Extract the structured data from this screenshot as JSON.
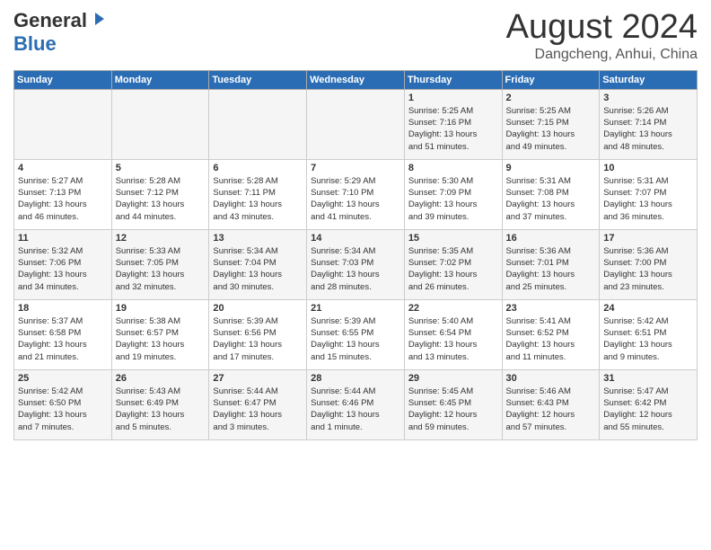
{
  "header": {
    "logo_general": "General",
    "logo_blue": "Blue",
    "month_title": "August 2024",
    "location": "Dangcheng, Anhui, China"
  },
  "weekdays": [
    "Sunday",
    "Monday",
    "Tuesday",
    "Wednesday",
    "Thursday",
    "Friday",
    "Saturday"
  ],
  "weeks": [
    [
      {
        "day": "",
        "info": ""
      },
      {
        "day": "",
        "info": ""
      },
      {
        "day": "",
        "info": ""
      },
      {
        "day": "",
        "info": ""
      },
      {
        "day": "1",
        "info": "Sunrise: 5:25 AM\nSunset: 7:16 PM\nDaylight: 13 hours\nand 51 minutes."
      },
      {
        "day": "2",
        "info": "Sunrise: 5:25 AM\nSunset: 7:15 PM\nDaylight: 13 hours\nand 49 minutes."
      },
      {
        "day": "3",
        "info": "Sunrise: 5:26 AM\nSunset: 7:14 PM\nDaylight: 13 hours\nand 48 minutes."
      }
    ],
    [
      {
        "day": "4",
        "info": "Sunrise: 5:27 AM\nSunset: 7:13 PM\nDaylight: 13 hours\nand 46 minutes."
      },
      {
        "day": "5",
        "info": "Sunrise: 5:28 AM\nSunset: 7:12 PM\nDaylight: 13 hours\nand 44 minutes."
      },
      {
        "day": "6",
        "info": "Sunrise: 5:28 AM\nSunset: 7:11 PM\nDaylight: 13 hours\nand 43 minutes."
      },
      {
        "day": "7",
        "info": "Sunrise: 5:29 AM\nSunset: 7:10 PM\nDaylight: 13 hours\nand 41 minutes."
      },
      {
        "day": "8",
        "info": "Sunrise: 5:30 AM\nSunset: 7:09 PM\nDaylight: 13 hours\nand 39 minutes."
      },
      {
        "day": "9",
        "info": "Sunrise: 5:31 AM\nSunset: 7:08 PM\nDaylight: 13 hours\nand 37 minutes."
      },
      {
        "day": "10",
        "info": "Sunrise: 5:31 AM\nSunset: 7:07 PM\nDaylight: 13 hours\nand 36 minutes."
      }
    ],
    [
      {
        "day": "11",
        "info": "Sunrise: 5:32 AM\nSunset: 7:06 PM\nDaylight: 13 hours\nand 34 minutes."
      },
      {
        "day": "12",
        "info": "Sunrise: 5:33 AM\nSunset: 7:05 PM\nDaylight: 13 hours\nand 32 minutes."
      },
      {
        "day": "13",
        "info": "Sunrise: 5:34 AM\nSunset: 7:04 PM\nDaylight: 13 hours\nand 30 minutes."
      },
      {
        "day": "14",
        "info": "Sunrise: 5:34 AM\nSunset: 7:03 PM\nDaylight: 13 hours\nand 28 minutes."
      },
      {
        "day": "15",
        "info": "Sunrise: 5:35 AM\nSunset: 7:02 PM\nDaylight: 13 hours\nand 26 minutes."
      },
      {
        "day": "16",
        "info": "Sunrise: 5:36 AM\nSunset: 7:01 PM\nDaylight: 13 hours\nand 25 minutes."
      },
      {
        "day": "17",
        "info": "Sunrise: 5:36 AM\nSunset: 7:00 PM\nDaylight: 13 hours\nand 23 minutes."
      }
    ],
    [
      {
        "day": "18",
        "info": "Sunrise: 5:37 AM\nSunset: 6:58 PM\nDaylight: 13 hours\nand 21 minutes."
      },
      {
        "day": "19",
        "info": "Sunrise: 5:38 AM\nSunset: 6:57 PM\nDaylight: 13 hours\nand 19 minutes."
      },
      {
        "day": "20",
        "info": "Sunrise: 5:39 AM\nSunset: 6:56 PM\nDaylight: 13 hours\nand 17 minutes."
      },
      {
        "day": "21",
        "info": "Sunrise: 5:39 AM\nSunset: 6:55 PM\nDaylight: 13 hours\nand 15 minutes."
      },
      {
        "day": "22",
        "info": "Sunrise: 5:40 AM\nSunset: 6:54 PM\nDaylight: 13 hours\nand 13 minutes."
      },
      {
        "day": "23",
        "info": "Sunrise: 5:41 AM\nSunset: 6:52 PM\nDaylight: 13 hours\nand 11 minutes."
      },
      {
        "day": "24",
        "info": "Sunrise: 5:42 AM\nSunset: 6:51 PM\nDaylight: 13 hours\nand 9 minutes."
      }
    ],
    [
      {
        "day": "25",
        "info": "Sunrise: 5:42 AM\nSunset: 6:50 PM\nDaylight: 13 hours\nand 7 minutes."
      },
      {
        "day": "26",
        "info": "Sunrise: 5:43 AM\nSunset: 6:49 PM\nDaylight: 13 hours\nand 5 minutes."
      },
      {
        "day": "27",
        "info": "Sunrise: 5:44 AM\nSunset: 6:47 PM\nDaylight: 13 hours\nand 3 minutes."
      },
      {
        "day": "28",
        "info": "Sunrise: 5:44 AM\nSunset: 6:46 PM\nDaylight: 13 hours\nand 1 minute."
      },
      {
        "day": "29",
        "info": "Sunrise: 5:45 AM\nSunset: 6:45 PM\nDaylight: 12 hours\nand 59 minutes."
      },
      {
        "day": "30",
        "info": "Sunrise: 5:46 AM\nSunset: 6:43 PM\nDaylight: 12 hours\nand 57 minutes."
      },
      {
        "day": "31",
        "info": "Sunrise: 5:47 AM\nSunset: 6:42 PM\nDaylight: 12 hours\nand 55 minutes."
      }
    ]
  ]
}
